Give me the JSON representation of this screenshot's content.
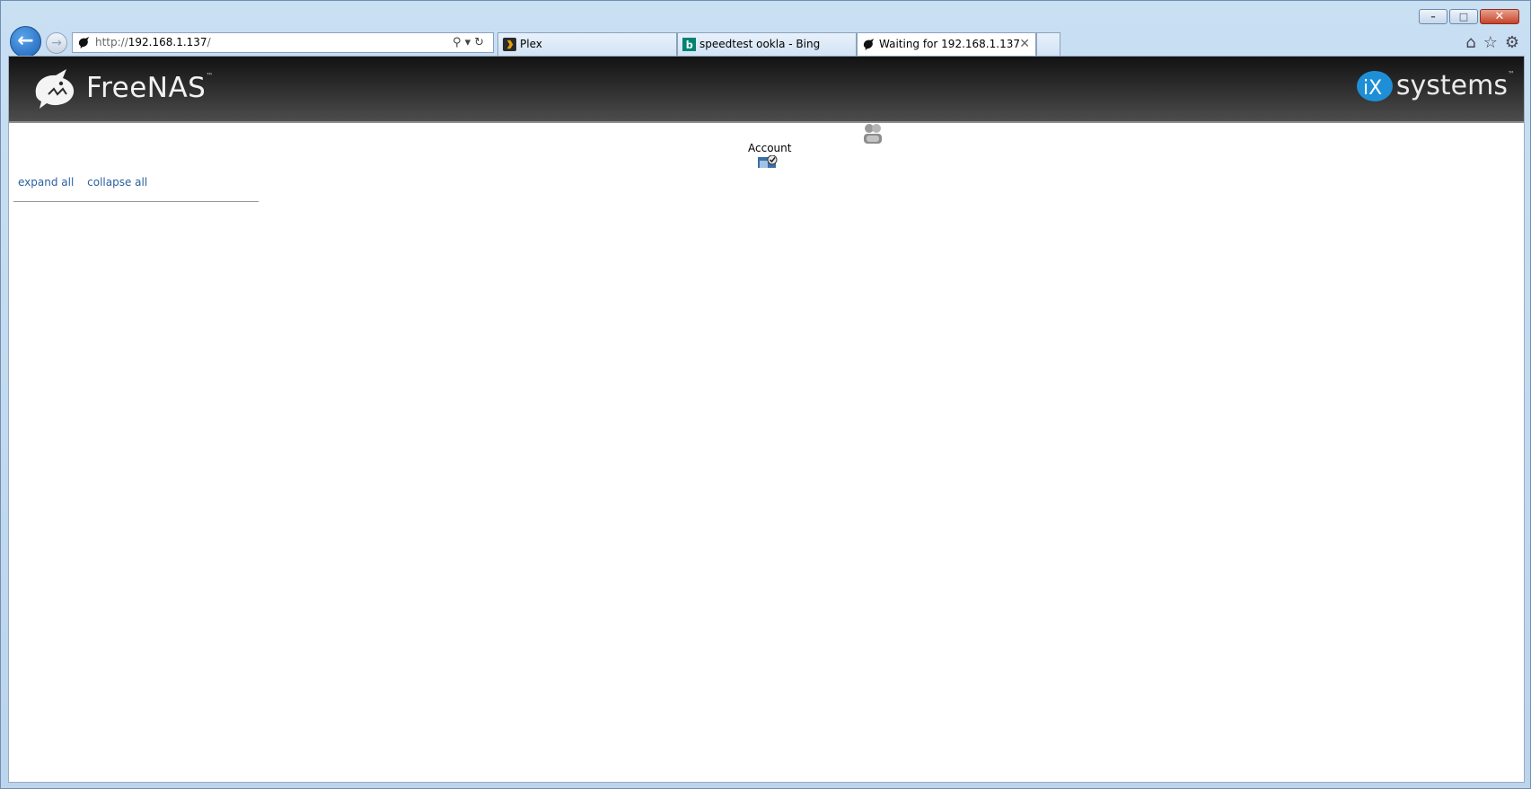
{
  "browser": {
    "address": {
      "scheme": "http://",
      "host": "192.168.1.137",
      "path": "/"
    },
    "tabs": [
      {
        "label": "Plex",
        "icon": "plex-icon"
      },
      {
        "label": "speedtest ookla - Bing",
        "icon": "bing-icon"
      },
      {
        "label": "Waiting for 192.168.1.137",
        "icon": "freenas-favicon",
        "active": true
      }
    ],
    "window_controls": {
      "minimize": "–",
      "maximize": "□",
      "close": "✕"
    }
  },
  "banner": {
    "product": "FreeNAS",
    "trademark": "™",
    "vendor_prefix": "iX",
    "vendor": "systems",
    "vendor_trademark": "™"
  },
  "toolbar": {
    "account_label": "Account"
  },
  "tree": {
    "expand_label": "expand all",
    "collapse_label": "collapse all"
  },
  "colors": {
    "banner_dark": "#121212",
    "link": "#2a5f9e",
    "ix_blue": "#1e8fd6"
  }
}
